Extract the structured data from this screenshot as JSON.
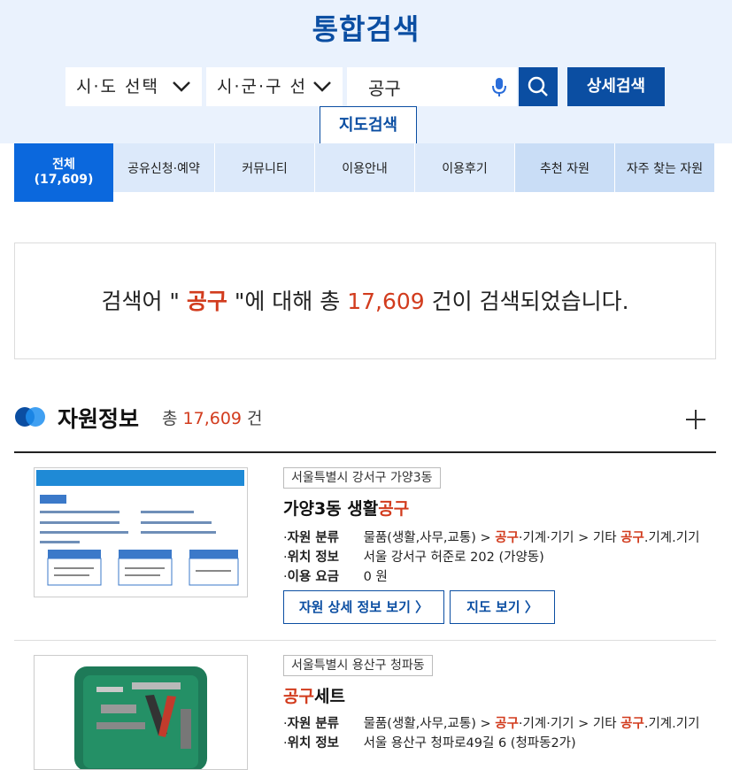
{
  "header": {
    "title": "통합검색",
    "sido_select": "시·도 선택",
    "sigungu_select": "시·군·구 선",
    "search_value": "공구",
    "detail_search": "상세검색",
    "map_search": "지도검색"
  },
  "tabs": [
    {
      "label": "전체",
      "count": "(17,609)"
    },
    {
      "label": "공유신청·예약"
    },
    {
      "label": "커뮤니티"
    },
    {
      "label": "이용안내"
    },
    {
      "label": "이용후기"
    },
    {
      "label": "추천 자원"
    },
    {
      "label": "자주 찾는 자원"
    }
  ],
  "summary": {
    "prefix": "검색어 \" ",
    "keyword": "공구",
    "middle": " \"에 대해 총 ",
    "count": "17,609",
    "suffix": " 건이 검색되었습니다."
  },
  "section": {
    "title": "자원정보",
    "count_prefix": "총 ",
    "count": "17,609",
    "count_suffix": " 건"
  },
  "results": [
    {
      "location": "서울특별시 강서구 가양3동",
      "title_pre": "가양3동 생활",
      "title_hl": "공구",
      "title_post": "",
      "category_label": "자원 분류",
      "category_pre": "물품(생활,사무,교통) > ",
      "category_hl1": "공구",
      "category_mid": "·기계·기기 > 기타 ",
      "category_hl2": "공구",
      "category_post": ".기계.기기",
      "location_label": "위치 정보",
      "address": "서울 강서구 허준로 202 (가양동)",
      "fee_label": "이용 요금",
      "fee": "0 원",
      "btn_detail": "자원 상세 정보 보기",
      "btn_map": "지도 보기"
    },
    {
      "location": "서울특별시 용산구 청파동",
      "title_pre": "",
      "title_hl": "공구",
      "title_post": "세트",
      "category_label": "자원 분류",
      "category_pre": "물품(생활,사무,교통) > ",
      "category_hl1": "공구",
      "category_mid": "·기계·기기 > 기타 ",
      "category_hl2": "공구",
      "category_post": ".기계.기기",
      "location_label": "위치 정보",
      "address": "서울 용산구 청파로49길 6 (청파동2가)"
    }
  ],
  "colors": {
    "primary": "#0b4ea2",
    "tab_active": "#0b68dd",
    "highlight": "#d23c1e"
  }
}
